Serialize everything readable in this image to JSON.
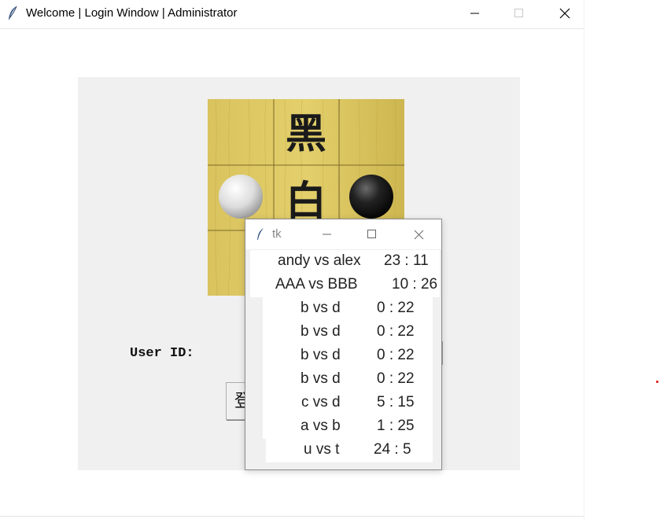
{
  "main_window": {
    "title": "Welcome | Login Window | Administrator",
    "icons": {
      "app": "feather-icon",
      "minimize": "minimize-icon",
      "maximize": "maximize-icon",
      "close": "close-icon"
    }
  },
  "login": {
    "board_caption_top": "黑",
    "board_caption_bottom": "白",
    "user_id_label": "User ID:",
    "user_id_value": "",
    "login_button_label": "登"
  },
  "tk_window": {
    "title": "tk",
    "results": [
      {
        "match": "andy vs alex",
        "score": "23 : 11"
      },
      {
        "match": "AAA vs BBB",
        "score": "10 : 26"
      },
      {
        "match": "b vs d",
        "score": "0 : 22"
      },
      {
        "match": "b vs d",
        "score": "0 : 22"
      },
      {
        "match": "b vs d",
        "score": "0 : 22"
      },
      {
        "match": "b vs d",
        "score": "0 : 22"
      },
      {
        "match": "c vs d",
        "score": "5 : 15"
      },
      {
        "match": "a vs b",
        "score": "1 : 25"
      },
      {
        "match": "u vs t",
        "score": "24 : 5"
      }
    ]
  },
  "colors": {
    "panel_bg": "#f0f0f0",
    "board_wood": "#d8c25c",
    "accent_red": "#e01010"
  }
}
